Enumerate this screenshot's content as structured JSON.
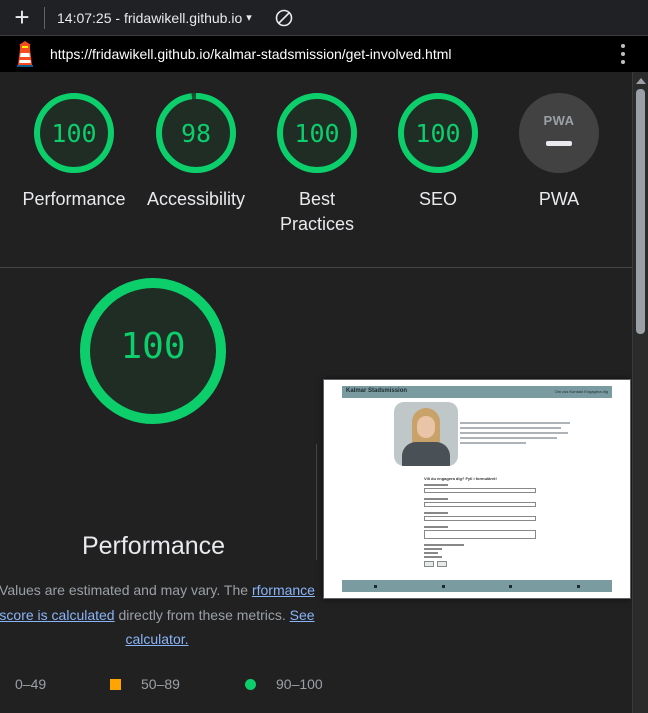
{
  "toolbar": {
    "time": "14:07:25",
    "separator": " - ",
    "host": "fridawikell.github.io",
    "caret": "▾"
  },
  "urlbar": {
    "url": "https://fridawikell.github.io/kalmar-stadsmission/get-involved.html"
  },
  "scores": [
    {
      "label": "Performance",
      "value": "100",
      "score": 100
    },
    {
      "label": "Accessibility",
      "value": "98",
      "score": 98
    },
    {
      "label": "Best\nPractices",
      "value": "100",
      "score": 100
    },
    {
      "label": "SEO",
      "value": "100",
      "score": 100
    }
  ],
  "pwa": {
    "badge": "PWA",
    "label": "PWA"
  },
  "performance": {
    "value": "100",
    "score": 100,
    "title": "Performance",
    "desc_prefix": "Values are estimated and may vary. The ",
    "desc_link1": "rformance score is calculated",
    "desc_middle": " directly from these metrics. ",
    "desc_link2": "See calculator."
  },
  "legend": {
    "red": "0–49",
    "orange": "50–89",
    "green": "90–100"
  },
  "thumbnail": {
    "brand": "Kalmar Stadsmission",
    "nav": "Om oss   Kontakt   Engagera dig",
    "form_title": "Vill du engagera dig? Fyll i formuläret!"
  },
  "colors": {
    "pass": "#0cce6b",
    "average": "#ffa400",
    "fail": "#ff4e42",
    "link": "#8ab4f8"
  }
}
